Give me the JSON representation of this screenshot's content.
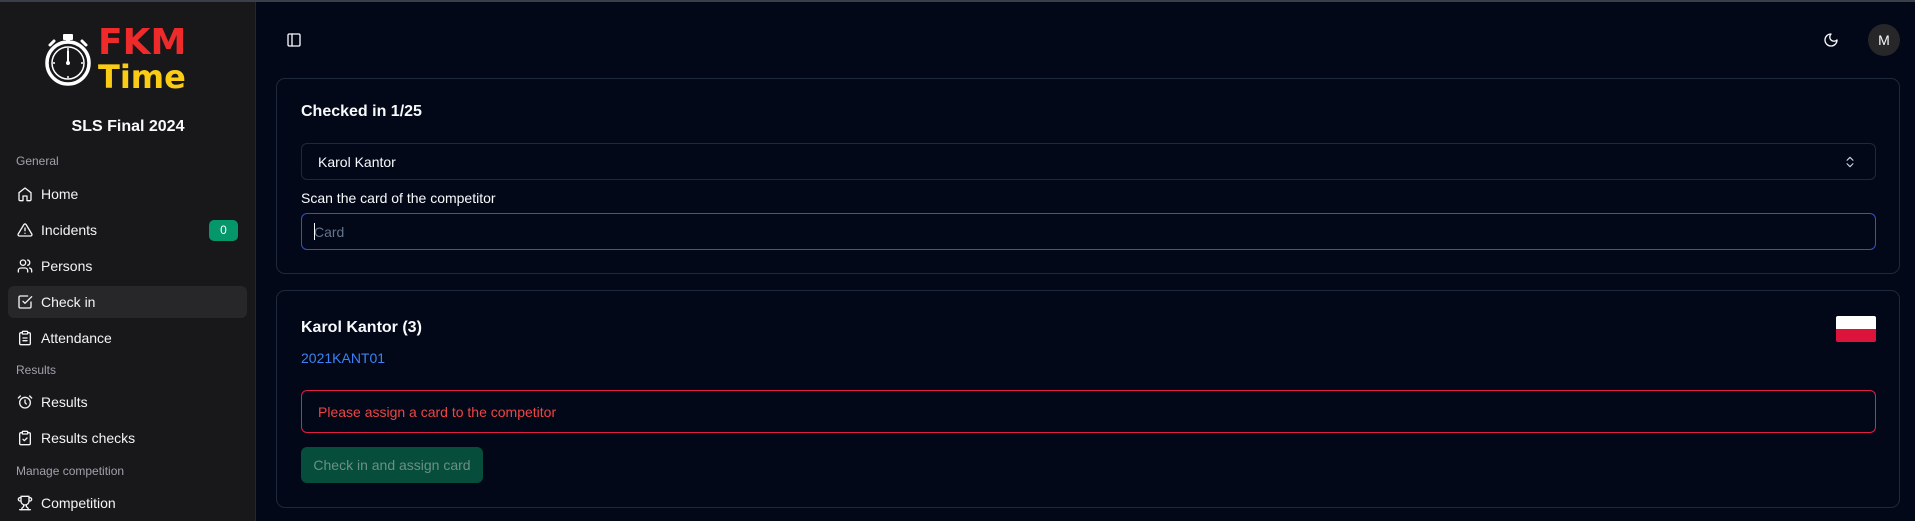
{
  "app": {
    "logo_line1": "FKM",
    "logo_line2": "Time",
    "competition_name": "SLS Final 2024"
  },
  "sidebar": {
    "groups": [
      {
        "label": "General"
      },
      {
        "label": "Results"
      },
      {
        "label": "Manage competition"
      }
    ],
    "items": [
      {
        "label": "Home",
        "icon": "home-icon"
      },
      {
        "label": "Incidents",
        "icon": "alert-triangle-icon",
        "badge": "0"
      },
      {
        "label": "Persons",
        "icon": "users-icon"
      },
      {
        "label": "Check in",
        "icon": "check-square-icon",
        "active": true
      },
      {
        "label": "Attendance",
        "icon": "clipboard-icon"
      },
      {
        "label": "Results",
        "icon": "alarm-clock-icon"
      },
      {
        "label": "Results checks",
        "icon": "clipboard-check-icon"
      },
      {
        "label": "Competition",
        "icon": "trophy-icon"
      }
    ]
  },
  "header": {
    "avatar_initial": "M"
  },
  "checkin_card": {
    "title": "Checked in 1/25",
    "selected_person": "Karol Kantor",
    "scan_label": "Scan the card of the competitor",
    "card_placeholder": "Card",
    "card_value": ""
  },
  "person_card": {
    "name": "Karol Kantor (3)",
    "wca_id": "2021KANT01",
    "flag": "poland-flag",
    "alert_text": "Please assign a card to the competitor",
    "button_label": "Check in and assign card"
  },
  "colors": {
    "background": "#020817",
    "sidebar": "#18181b",
    "accent_badge": "#059669",
    "link": "#3b82f6",
    "error": "#ef4444",
    "focus_ring": "#3b4fc8"
  }
}
